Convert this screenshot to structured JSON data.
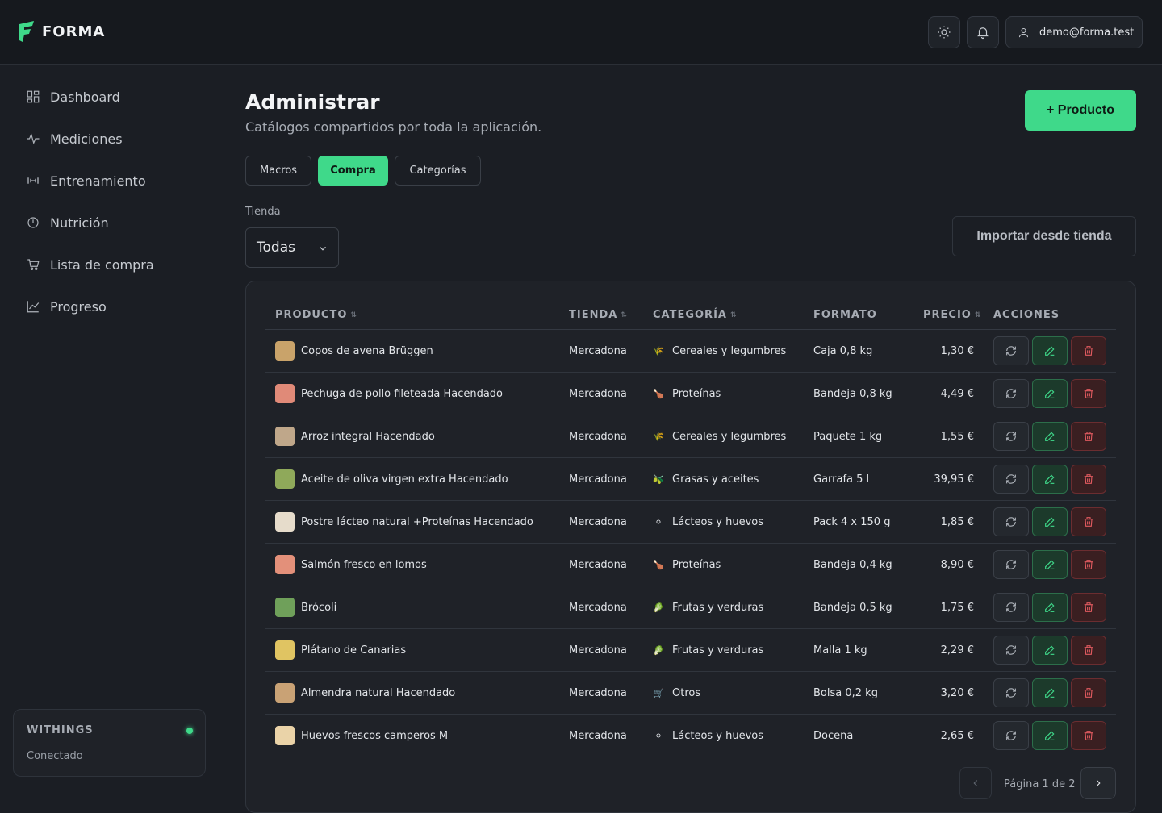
{
  "app": {
    "name": "FORMA",
    "accent": "#3fd98a"
  },
  "header": {
    "user_email": "demo@forma.test"
  },
  "sidebar": {
    "items": [
      {
        "label": "Dashboard",
        "icon": "dashboard-icon"
      },
      {
        "label": "Mediciones",
        "icon": "activity-icon"
      },
      {
        "label": "Entrenamiento",
        "icon": "dumbbell-icon"
      },
      {
        "label": "Nutrición",
        "icon": "timer-icon"
      },
      {
        "label": "Lista de compra",
        "icon": "cart-icon"
      },
      {
        "label": "Progreso",
        "icon": "chart-line-icon"
      }
    ],
    "integration": {
      "name": "WITHINGS",
      "status": "Conectado"
    }
  },
  "page": {
    "title": "Administrar",
    "subtitle": "Catálogos compartidos por toda la aplicación.",
    "add_label": "+ Producto",
    "tabs": [
      "Macros",
      "Compra",
      "Categorías"
    ],
    "active_tab": "Compra",
    "store_label": "Tienda",
    "store_value": "Todas",
    "import_label": "Importar desde tienda"
  },
  "table": {
    "columns": {
      "product": "PRODUCTO",
      "store": "TIENDA",
      "category": "CATEGORÍA",
      "format": "FORMATO",
      "price": "PRECIO",
      "actions": "ACCIONES"
    },
    "rows": [
      {
        "product": "Copos de avena Brüggen",
        "store": "Mercadona",
        "category": "Cereales y legumbres",
        "cat_icon": "🌾",
        "format": "Caja 0,8 kg",
        "price": "1,30 €",
        "color": "#c9a36a"
      },
      {
        "product": "Pechuga de pollo fileteada Hacendado",
        "store": "Mercadona",
        "category": "Proteínas",
        "cat_icon": "🍗",
        "format": "Bandeja 0,8 kg",
        "price": "4,49 €",
        "color": "#e08a78"
      },
      {
        "product": "Arroz integral Hacendado",
        "store": "Mercadona",
        "category": "Cereales y legumbres",
        "cat_icon": "🌾",
        "format": "Paquete 1 kg",
        "price": "1,55 €",
        "color": "#bfa78a"
      },
      {
        "product": "Aceite de oliva virgen extra Hacendado",
        "store": "Mercadona",
        "category": "Grasas y aceites",
        "cat_icon": "🫒",
        "format": "Garrafa 5 l",
        "price": "39,95 €",
        "color": "#8fa95a"
      },
      {
        "product": "Postre lácteo natural +Proteínas Hacendado",
        "store": "Mercadona",
        "category": "Lácteos y huevos",
        "cat_icon": "⚪",
        "format": "Pack 4 x 150 g",
        "price": "1,85 €",
        "color": "#e6dccb"
      },
      {
        "product": "Salmón fresco en lomos",
        "store": "Mercadona",
        "category": "Proteínas",
        "cat_icon": "🍗",
        "format": "Bandeja 0,4 kg",
        "price": "8,90 €",
        "color": "#e3907a"
      },
      {
        "product": "Brócoli",
        "store": "Mercadona",
        "category": "Frutas y verduras",
        "cat_icon": "🥬",
        "format": "Bandeja 0,5 kg",
        "price": "1,75 €",
        "color": "#6fa05a"
      },
      {
        "product": "Plátano de Canarias",
        "store": "Mercadona",
        "category": "Frutas y verduras",
        "cat_icon": "🥬",
        "format": "Malla 1 kg",
        "price": "2,29 €",
        "color": "#e0c462"
      },
      {
        "product": "Almendra natural Hacendado",
        "store": "Mercadona",
        "category": "Otros",
        "cat_icon": "🛒",
        "format": "Bolsa 0,2 kg",
        "price": "3,20 €",
        "color": "#c9a275"
      },
      {
        "product": "Huevos frescos camperos M",
        "store": "Mercadona",
        "category": "Lácteos y huevos",
        "cat_icon": "⚪",
        "format": "Docena",
        "price": "2,65 €",
        "color": "#ead3a8"
      }
    ]
  },
  "pagination": {
    "text": "Página 1 de 2"
  }
}
